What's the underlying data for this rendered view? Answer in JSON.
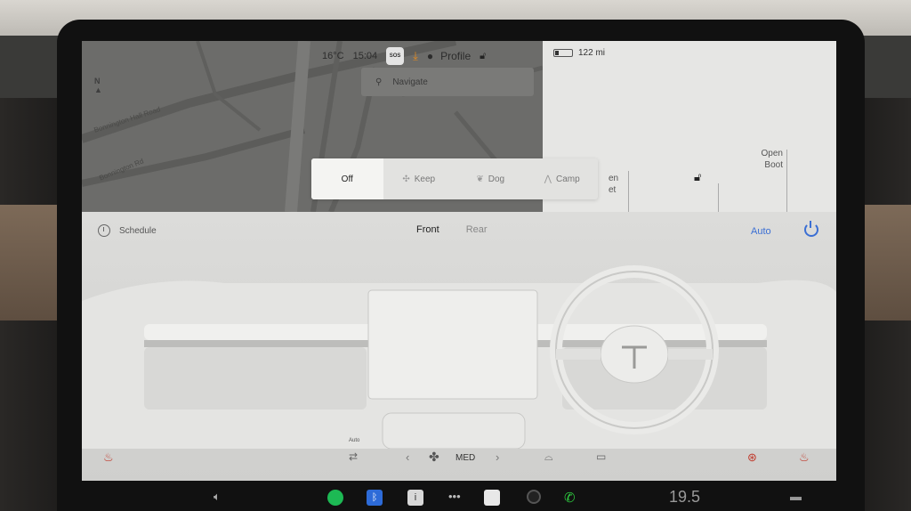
{
  "status_bar": {
    "temperature": "16°C",
    "time": "15:04",
    "sos": "SOS",
    "profile": "Profile",
    "battery_range": "122 mi",
    "battery_fraction": 0.2
  },
  "map": {
    "search_placeholder": "Navigate",
    "compass_label": "N",
    "road_1": "Bonnington Hall Road",
    "road_2": "Bonnington Rd"
  },
  "car_panel": {
    "open_boot_line1": "Open",
    "open_boot_line2": "Boot",
    "frunk_line1": "en",
    "frunk_line2": "et"
  },
  "modes": {
    "items": [
      {
        "label": "Off",
        "icon": "off"
      },
      {
        "label": "Keep",
        "icon": "fan-icon"
      },
      {
        "label": "Dog",
        "icon": "dog-icon"
      },
      {
        "label": "Camp",
        "icon": "camp-icon"
      }
    ],
    "active": "Off"
  },
  "climate": {
    "schedule_label": "Schedule",
    "tabs": [
      "Front",
      "Rear"
    ],
    "active_tab": "Front",
    "auto_label": "Auto",
    "auto_small_label": "Auto",
    "fan_label": "MED"
  },
  "dock": {
    "cabin_temp": "19.5"
  },
  "colors": {
    "accent": "#3b6fd4",
    "seat_heat": "#c0392b",
    "download": "#e58a1e",
    "spotify": "#1db954",
    "bluetooth": "#2d6bd8",
    "phone": "#2ecc40"
  }
}
